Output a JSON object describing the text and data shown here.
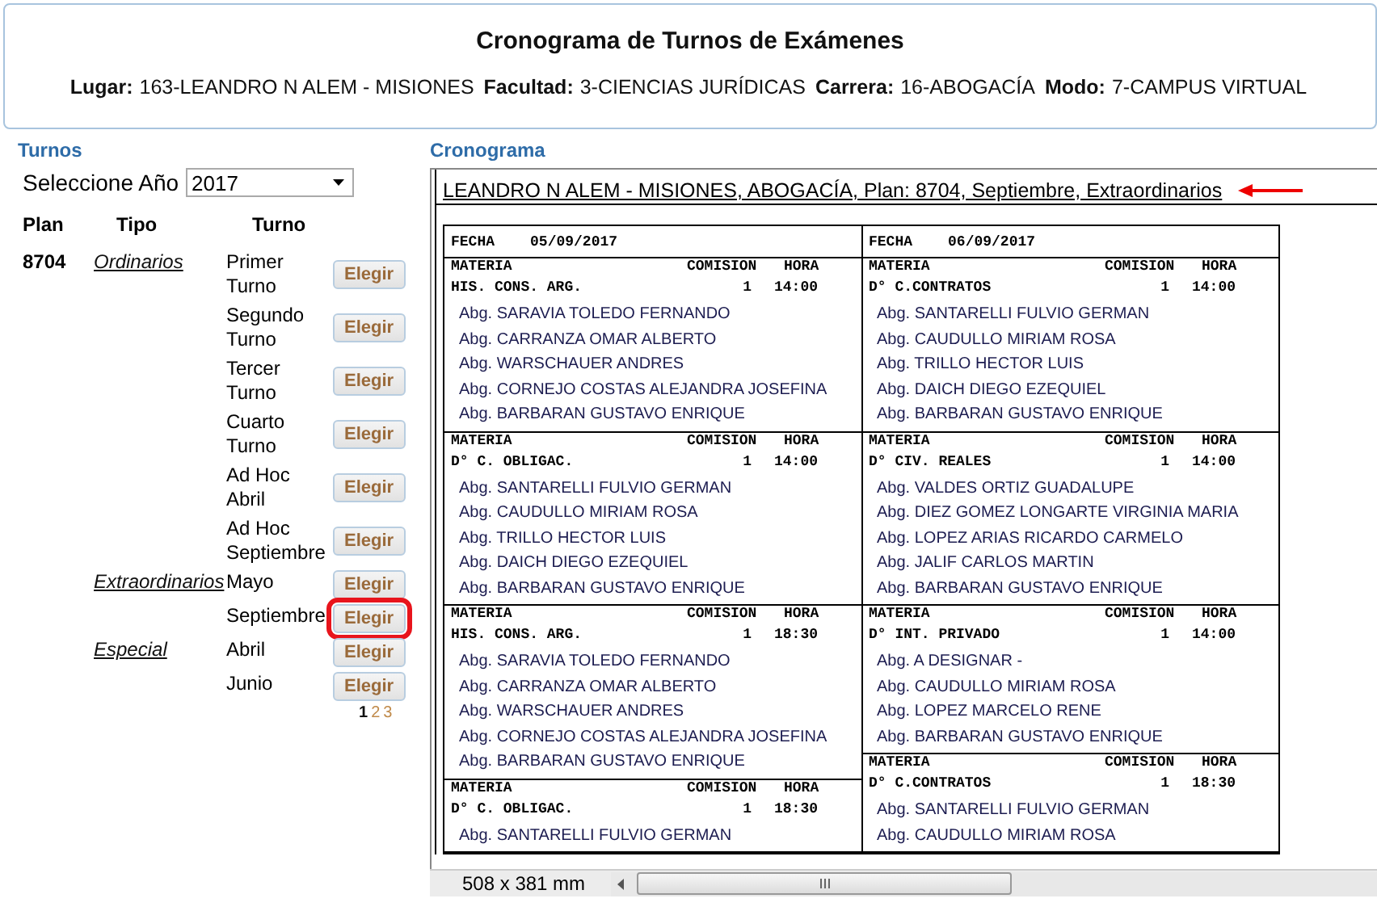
{
  "header": {
    "title": "Cronograma de Turnos de Exámenes",
    "fields": [
      {
        "label": "Lugar:",
        "value": "163-LEANDRO N ALEM - MISIONES"
      },
      {
        "label": "Facultad:",
        "value": "3-CIENCIAS JURÍDICAS"
      },
      {
        "label": "Carrera:",
        "value": "16-ABOGACÍA"
      },
      {
        "label": "Modo:",
        "value": "7-CAMPUS VIRTUAL"
      }
    ]
  },
  "turnos": {
    "title": "Turnos",
    "year_label": "Seleccione Año",
    "year": "2017",
    "columns": [
      "Plan",
      "Tipo",
      "Turno"
    ],
    "plans": [
      {
        "plan": "8704",
        "tipos": [
          {
            "name": "Ordinarios",
            "turnos": [
              {
                "label": "Primer Turno",
                "button": "Elegir",
                "highlighted": false
              },
              {
                "label": "Segundo Turno",
                "button": "Elegir",
                "highlighted": false
              },
              {
                "label": "Tercer Turno",
                "button": "Elegir",
                "highlighted": false
              },
              {
                "label": "Cuarto Turno",
                "button": "Elegir",
                "highlighted": false
              },
              {
                "label": "Ad Hoc Abril",
                "button": "Elegir",
                "highlighted": false
              },
              {
                "label": "Ad Hoc Septiembre",
                "button": "Elegir",
                "highlighted": false
              }
            ]
          },
          {
            "name": "Extraordinarios",
            "turnos": [
              {
                "label": "Mayo",
                "button": "Elegir",
                "highlighted": false
              },
              {
                "label": "Septiembre",
                "button": "Elegir",
                "highlighted": true
              }
            ]
          },
          {
            "name": "Especial",
            "turnos": [
              {
                "label": "Abril",
                "button": "Elegir",
                "highlighted": false
              },
              {
                "label": "Junio",
                "button": "Elegir",
                "highlighted": false
              }
            ]
          }
        ]
      }
    ],
    "pages": [
      {
        "label": "1",
        "selected": true
      },
      {
        "label": "2",
        "selected": false
      },
      {
        "label": "3",
        "selected": false
      }
    ]
  },
  "cronograma": {
    "title": "Cronograma",
    "doc_title": "LEANDRO N ALEM - MISIONES,  ABOGACÍA, Plan: 8704, Septiembre, Extraordinarios",
    "status": "508 x 381 mm",
    "days": [
      {
        "fecha_label": "FECHA",
        "fecha": "05/09/2017",
        "blocks": [
          {
            "header": [
              "MATERIA",
              "COMISION",
              "HORA"
            ],
            "materia": "HIS. CONS. ARG.",
            "comision": "1",
            "hora": "14:00",
            "docentes": [
              "Abg. SARAVIA TOLEDO FERNANDO",
              "Abg. CARRANZA OMAR ALBERTO",
              "Abg. WARSCHAUER ANDRES",
              "Abg. CORNEJO COSTAS ALEJANDRA JOSEFINA",
              "Abg. BARBARAN GUSTAVO ENRIQUE"
            ]
          },
          {
            "header": [
              "MATERIA",
              "COMISION",
              "HORA"
            ],
            "materia": "D° C. OBLIGAC.",
            "comision": "1",
            "hora": "14:00",
            "docentes": [
              "Abg. SANTARELLI FULVIO GERMAN",
              "Abg. CAUDULLO MIRIAM ROSA",
              "Abg. TRILLO HECTOR LUIS",
              "Abg. DAICH DIEGO EZEQUIEL",
              "Abg. BARBARAN GUSTAVO ENRIQUE"
            ]
          },
          {
            "header": [
              "MATERIA",
              "COMISION",
              "HORA"
            ],
            "materia": "HIS. CONS. ARG.",
            "comision": "1",
            "hora": "18:30",
            "docentes": [
              "Abg. SARAVIA TOLEDO FERNANDO",
              "Abg. CARRANZA OMAR ALBERTO",
              "Abg. WARSCHAUER ANDRES",
              "Abg. CORNEJO COSTAS ALEJANDRA JOSEFINA",
              "Abg. BARBARAN GUSTAVO ENRIQUE"
            ]
          },
          {
            "header": [
              "MATERIA",
              "COMISION",
              "HORA"
            ],
            "materia": "D° C. OBLIGAC.",
            "comision": "1",
            "hora": "18:30",
            "docentes": [
              "Abg. SANTARELLI FULVIO GERMAN"
            ]
          }
        ]
      },
      {
        "fecha_label": "FECHA",
        "fecha": "06/09/2017",
        "blocks": [
          {
            "header": [
              "MATERIA",
              "COMISION",
              "HORA"
            ],
            "materia": "D° C.CONTRATOS",
            "comision": "1",
            "hora": "14:00",
            "docentes": [
              "Abg. SANTARELLI FULVIO GERMAN",
              "Abg. CAUDULLO MIRIAM ROSA",
              "Abg. TRILLO HECTOR LUIS",
              "Abg. DAICH DIEGO EZEQUIEL",
              "Abg. BARBARAN GUSTAVO ENRIQUE"
            ]
          },
          {
            "header": [
              "MATERIA",
              "COMISION",
              "HORA"
            ],
            "materia": "D° CIV. REALES",
            "comision": "1",
            "hora": "14:00",
            "docentes": [
              "Abg. VALDES ORTIZ GUADALUPE",
              "Abg. DIEZ GOMEZ LONGARTE VIRGINIA MARIA",
              "Abg. LOPEZ ARIAS RICARDO CARMELO",
              "Abg. JALIF CARLOS MARTIN",
              "Abg. BARBARAN GUSTAVO ENRIQUE"
            ]
          },
          {
            "header": [
              "MATERIA",
              "COMISION",
              "HORA"
            ],
            "materia": "D° INT. PRIVADO",
            "comision": "1",
            "hora": "14:00",
            "docentes": [
              "Abg. A DESIGNAR -",
              "Abg. CAUDULLO MIRIAM ROSA",
              "Abg. LOPEZ MARCELO RENE",
              "Abg. BARBARAN GUSTAVO ENRIQUE"
            ]
          },
          {
            "header": [
              "MATERIA",
              "COMISION",
              "HORA"
            ],
            "materia": "D° C.CONTRATOS",
            "comision": "1",
            "hora": "18:30",
            "docentes": [
              "Abg. SANTARELLI FULVIO GERMAN",
              "Abg. CAUDULLO MIRIAM ROSA"
            ]
          }
        ]
      }
    ]
  }
}
